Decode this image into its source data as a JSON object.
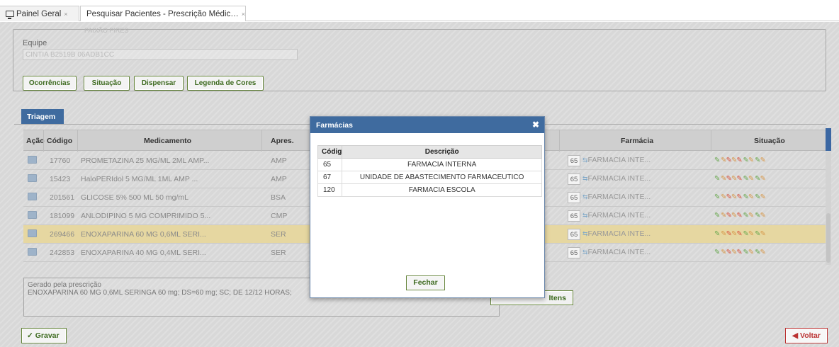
{
  "tabs": [
    {
      "label": "Painel Geral",
      "close": "×"
    },
    {
      "label": "Pesquisar Pacientes - Prescrição Médic…",
      "close": "×"
    }
  ],
  "form": {
    "ghost_text": "PAIXÃO PIRES",
    "equipe_label": "Equipe",
    "equipe_value": "CINTIA B2519B 06ADB1CC"
  },
  "actions": [
    "Ocorrências",
    "Situação",
    "Dispensar",
    "Legenda de Cores"
  ],
  "triagem_tab": "Triagem",
  "grid": {
    "headers": {
      "acao": "Ação",
      "codigo": "Código",
      "medicamento": "Medicamento",
      "apres": "Apres.",
      "farmacia": "Farmácia",
      "situacao": "Situação"
    },
    "rows": [
      {
        "codigo": "17760",
        "medicamento": "PROMETAZINA 25 MG/ML 2ML AMP...",
        "apres": "AMP",
        "farm_code": "65",
        "farm_name": "FARMACIA INTE...",
        "selected": false
      },
      {
        "codigo": "15423",
        "medicamento": "HaloPERIdol 5 MG/ML 1ML AMP ...",
        "apres": "AMP",
        "farm_code": "65",
        "farm_name": "FARMACIA INTE...",
        "selected": false
      },
      {
        "codigo": "201561",
        "medicamento": "GLICOSE 5% 500 ML 50 mg/mL",
        "apres": "BSA",
        "farm_code": "65",
        "farm_name": "FARMACIA INTE...",
        "selected": false
      },
      {
        "codigo": "181099",
        "medicamento": "ANLODIPINO 5 MG COMPRIMIDO 5...",
        "apres": "CMP",
        "farm_code": "65",
        "farm_name": "FARMACIA INTE...",
        "selected": false
      },
      {
        "codigo": "269466",
        "medicamento": "ENOXAPARINA 60 MG 0,6ML SERI...",
        "apres": "SER",
        "farm_code": "65",
        "farm_name": "FARMACIA INTE...",
        "selected": true
      },
      {
        "codigo": "242853",
        "medicamento": "ENOXAPARINA 40 MG 0,4ML SERI...",
        "apres": "SER",
        "farm_code": "65",
        "farm_name": "FARMACIA INTE...",
        "selected": false
      }
    ]
  },
  "obs": {
    "line1": "Gerado pela prescrição",
    "line2": "ENOXAPARINA 60 MG 0,6ML SERINGA 60 mg; DS=60 mg; SC; DE 12/12 HORAS;"
  },
  "btn_itens": "Itens",
  "btn_gravar": "Gravar",
  "btn_voltar": "Voltar",
  "modal": {
    "title": "Farmácias",
    "headers": {
      "codigo": "Códig",
      "descricao": "Descrição"
    },
    "rows": [
      {
        "codigo": "65",
        "descricao": "FARMACIA INTERNA"
      },
      {
        "codigo": "67",
        "descricao": "UNIDADE DE ABASTECIMENTO FARMACEUTICO"
      },
      {
        "codigo": "120",
        "descricao": "FARMACIA ESCOLA"
      }
    ],
    "fechar": "Fechar"
  }
}
